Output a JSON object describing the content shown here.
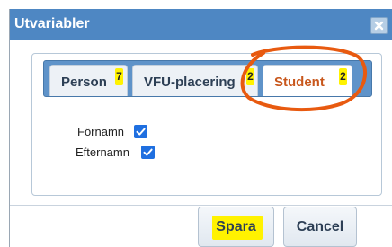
{
  "dialog": {
    "title": "Utvariabler",
    "close_icon": "close-x-icon"
  },
  "tabs": [
    {
      "label": "Person",
      "badge": "7",
      "active": false
    },
    {
      "label": "VFU-placering",
      "badge": "2",
      "active": false
    },
    {
      "label": "Student",
      "badge": "2",
      "active": true
    }
  ],
  "fields": [
    {
      "label": "Förnamn",
      "checked": true
    },
    {
      "label": "Efternamn",
      "checked": true
    }
  ],
  "buttons": {
    "save_label": "Spara",
    "cancel_label": "Cancel"
  },
  "colors": {
    "title_bar": "#4e87c3",
    "active_tab_text": "#c8571c",
    "checkbox": "#1f6fe0",
    "highlight": "#fff200",
    "annotation": "#e85a10"
  }
}
